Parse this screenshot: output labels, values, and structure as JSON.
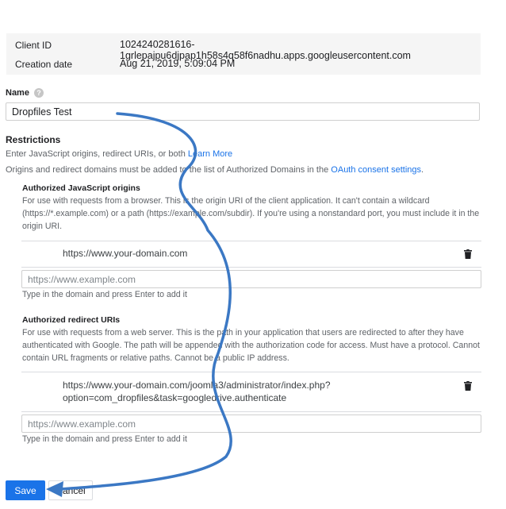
{
  "info": {
    "client_id_label": "Client ID",
    "client_id_value": "1024240281616-1grlepajpu6djpap1h58s4q58f6nadhu.apps.googleusercontent.com",
    "creation_label": "Creation date",
    "creation_value": "Aug 21, 2019, 5:09:04 PM"
  },
  "name": {
    "label": "Name",
    "help": "?",
    "value": "Dropfiles Test"
  },
  "restrictions": {
    "title": "Restrictions",
    "line1_text": "Enter JavaScript origins, redirect URIs, or both",
    "line1_link": "Learn More",
    "line2_text": "Origins and redirect domains must be added to the list of Authorized Domains in the",
    "line2_link": "OAuth consent settings",
    "line2_end": "."
  },
  "js_origins": {
    "title": "Authorized JavaScript origins",
    "description": "For use with requests from a browser. This is the origin URI of the client application. It can't contain a wildcard (https://*.example.com) or a path (https://example.com/subdir). If you're using a nonstandard port, you must include it in the origin URI.",
    "uri": "https://www.your-domain.com",
    "placeholder": "https://www.example.com",
    "hint": "Type in the domain and press Enter to add it"
  },
  "redirect_uris": {
    "title": "Authorized redirect URIs",
    "description": "For use with requests from a web server. This is the path in your application that users are redirected to after they have authenticated with Google. The path will be appended with the authorization code for access. Must have a protocol. Cannot contain URL fragments or relative paths. Cannot be a public IP address.",
    "uri_line1": "https://www.your-domain.com/joomla3/administrator/index.php?",
    "uri_line2": "option=com_dropfiles&task=googledrive.authenticate",
    "placeholder": "https://www.example.com",
    "hint": "Type in the domain and press Enter to add it"
  },
  "actions": {
    "save": "Save",
    "cancel": "Cancel"
  },
  "colors": {
    "accent": "#1a73e8",
    "annotation_arrow": "#3b78c4"
  },
  "icons": [
    "help-icon",
    "trash-icon",
    "arrow-annotation"
  ]
}
